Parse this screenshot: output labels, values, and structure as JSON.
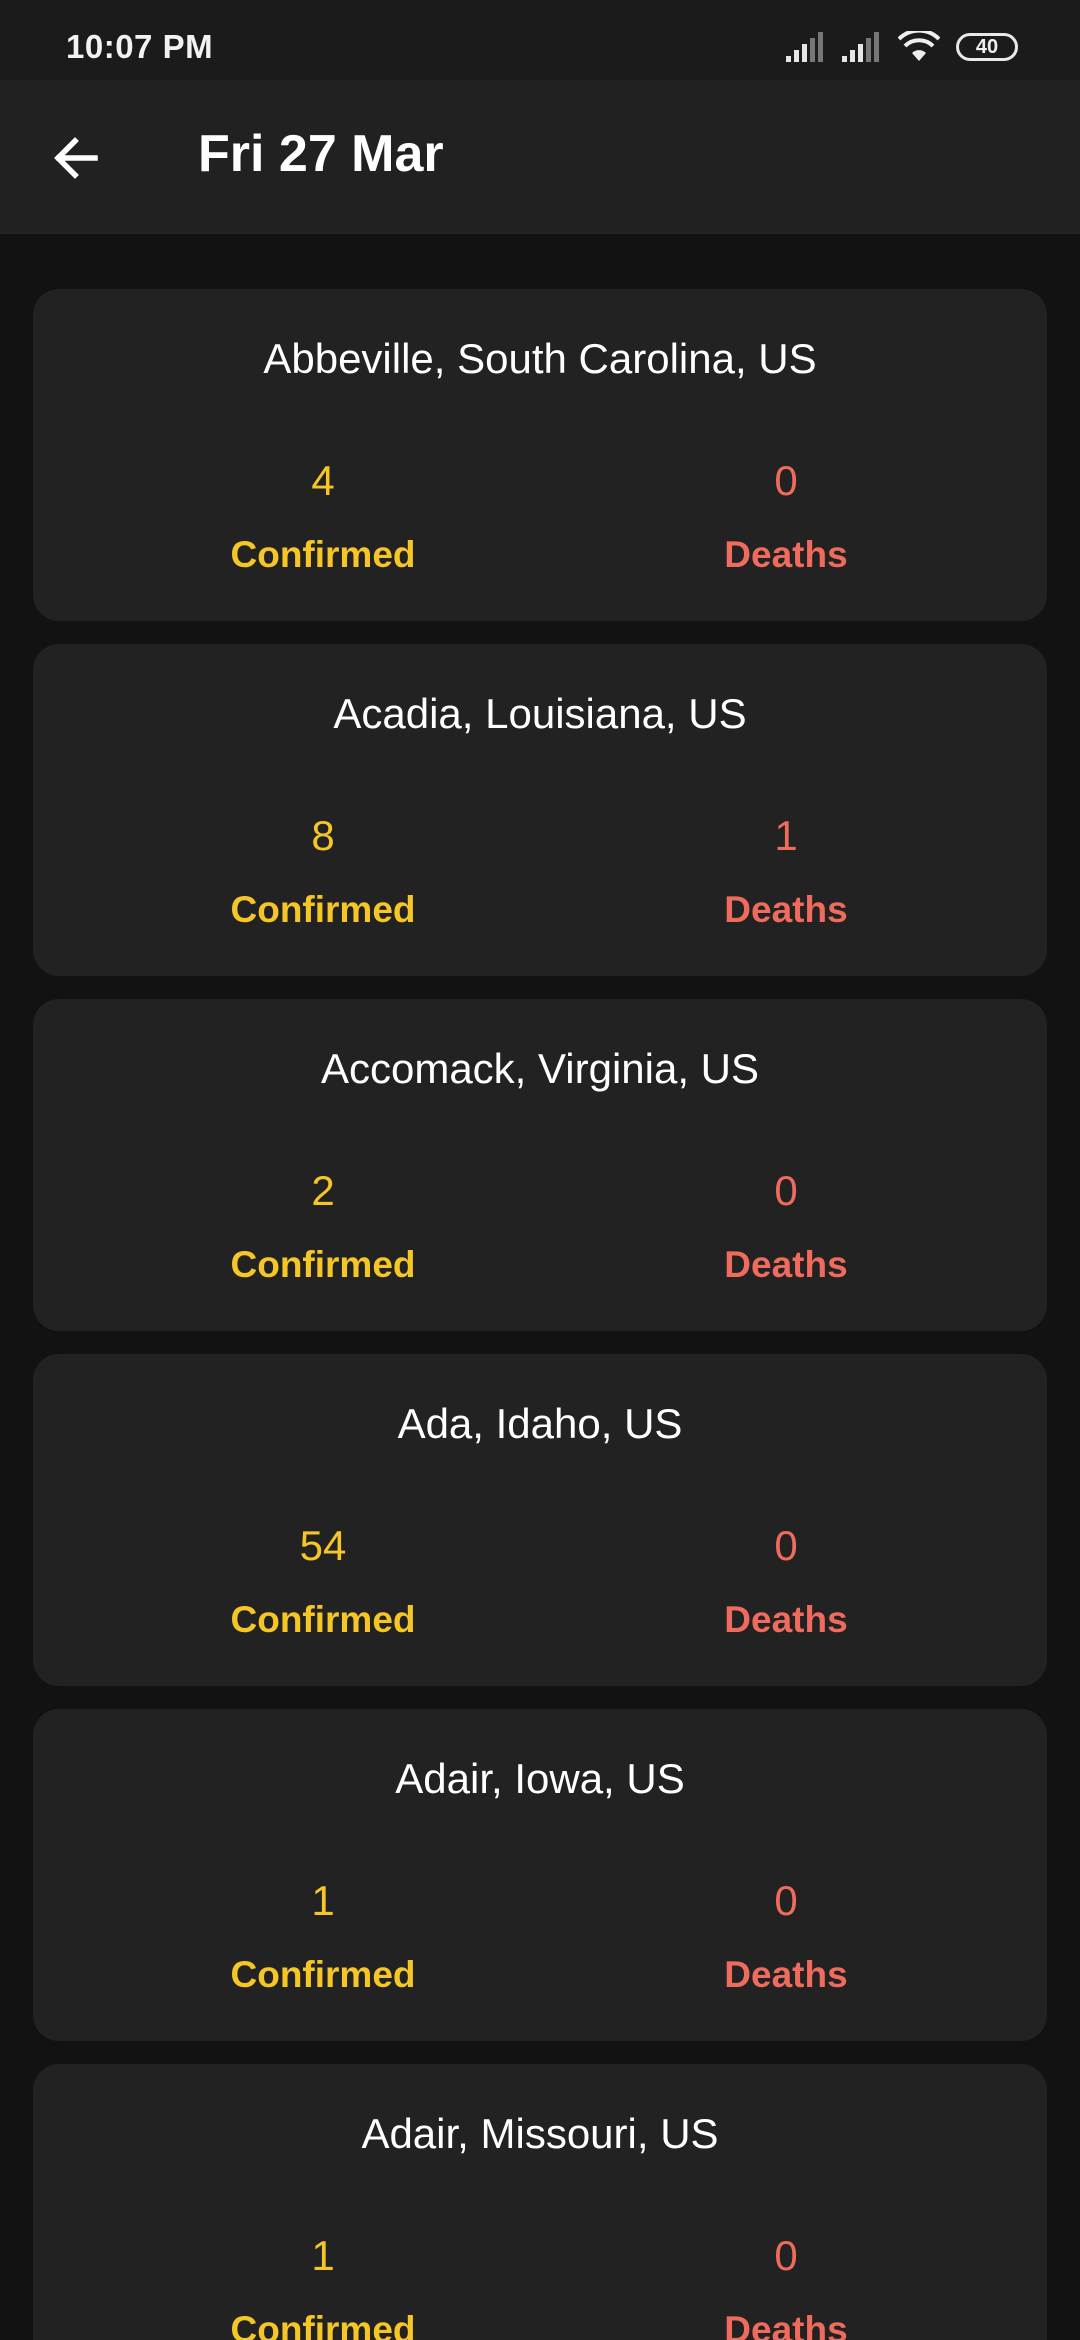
{
  "status_bar": {
    "time": "10:07 PM",
    "battery": "40"
  },
  "app_bar": {
    "title": "Fri 27 Mar"
  },
  "cards": [
    {
      "location": "Abbeville, South Carolina, US",
      "confirmed": "4",
      "deaths": "0",
      "confirmed_label": "Confirmed",
      "deaths_label": "Deaths"
    },
    {
      "location": "Acadia, Louisiana, US",
      "confirmed": "8",
      "deaths": "1",
      "confirmed_label": "Confirmed",
      "deaths_label": "Deaths"
    },
    {
      "location": "Accomack, Virginia, US",
      "confirmed": "2",
      "deaths": "0",
      "confirmed_label": "Confirmed",
      "deaths_label": "Deaths"
    },
    {
      "location": "Ada, Idaho, US",
      "confirmed": "54",
      "deaths": "0",
      "confirmed_label": "Confirmed",
      "deaths_label": "Deaths"
    },
    {
      "location": "Adair, Iowa, US",
      "confirmed": "1",
      "deaths": "0",
      "confirmed_label": "Confirmed",
      "deaths_label": "Deaths"
    },
    {
      "location": "Adair, Missouri, US",
      "confirmed": "1",
      "deaths": "0",
      "confirmed_label": "Confirmed",
      "deaths_label": "Deaths"
    }
  ],
  "colors": {
    "confirmed": "#f6c627",
    "deaths": "#ee6b5d",
    "card_background": "#222222",
    "app_bar_background": "#212121"
  },
  "icons": {
    "back": "arrow-back-icon",
    "signal": "cell-signal-icon",
    "wifi": "wifi-icon",
    "battery": "battery-icon"
  }
}
